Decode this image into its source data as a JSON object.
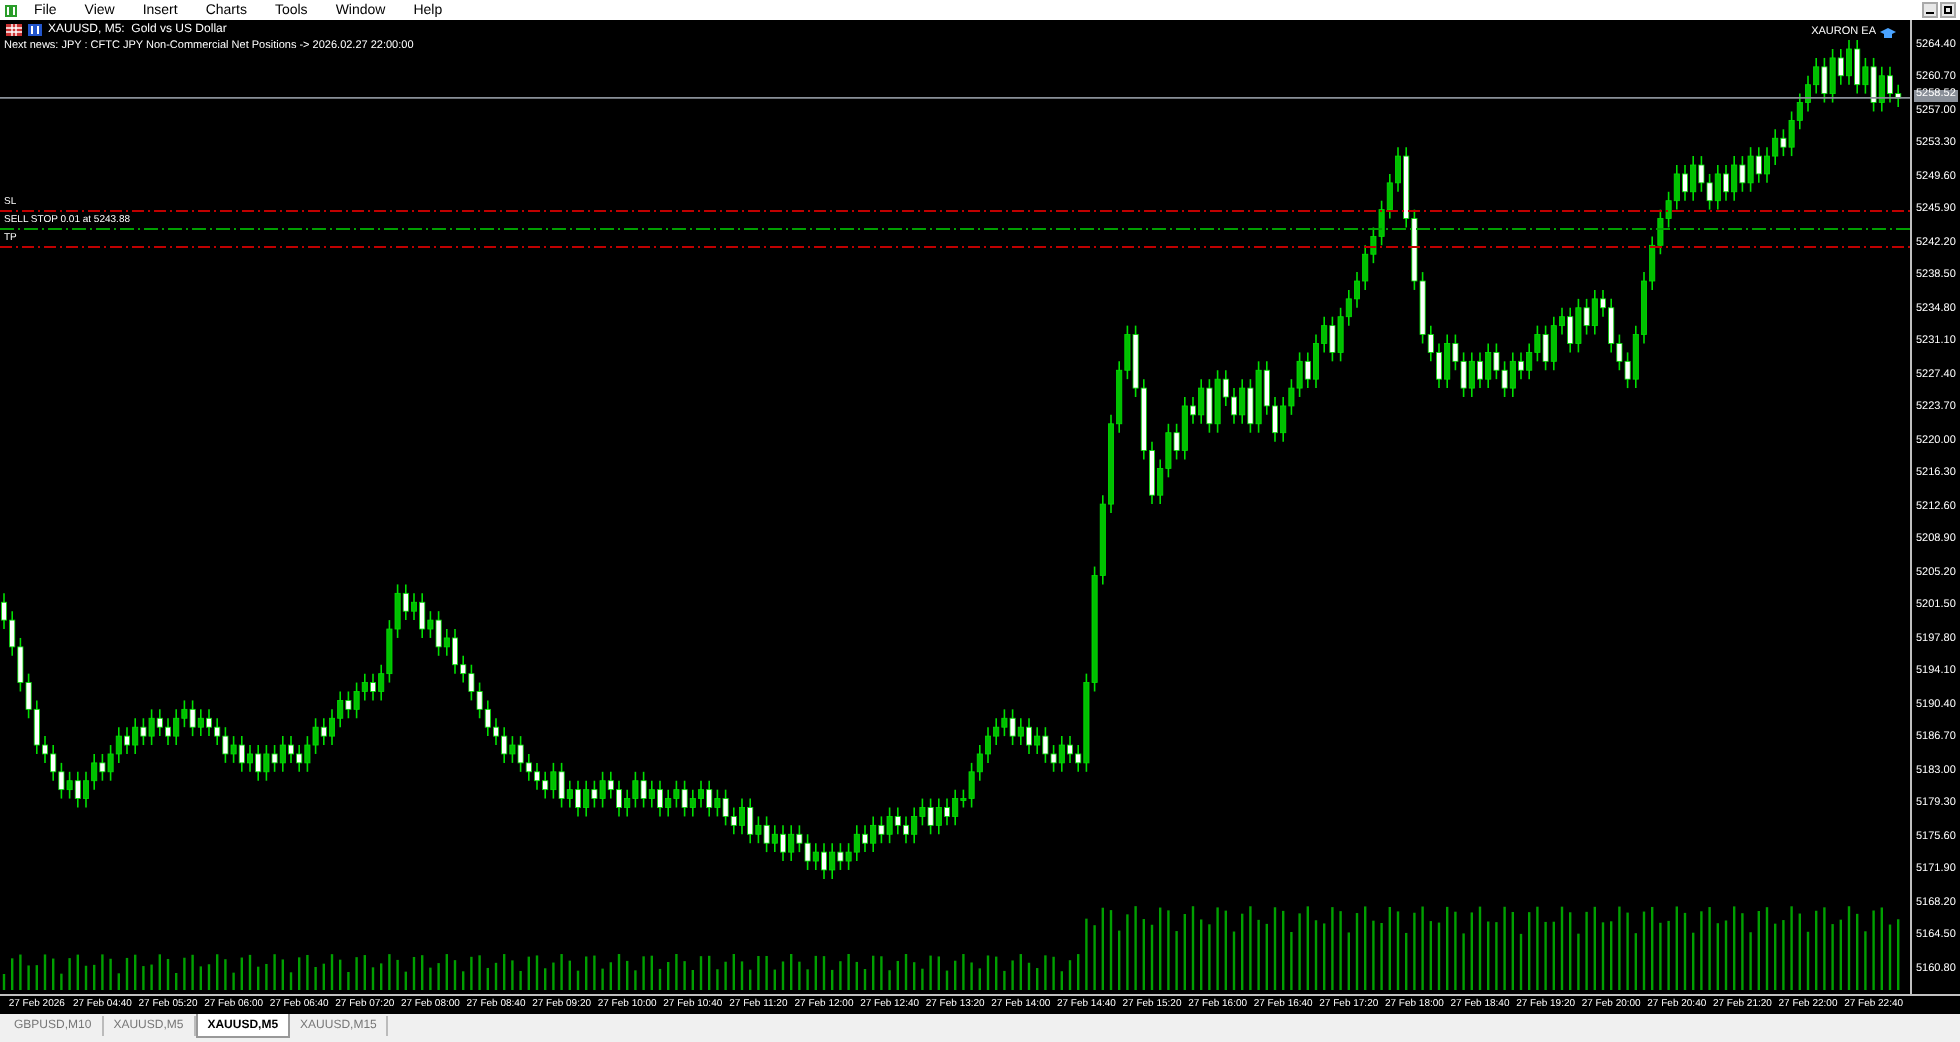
{
  "menu": {
    "items": [
      "File",
      "View",
      "Insert",
      "Charts",
      "Tools",
      "Window",
      "Help"
    ]
  },
  "chart": {
    "title": "XAUUSD, M5:  Gold vs US Dollar",
    "news": "Next news: JPY : CFTC JPY Non-Commercial Net Positions -> 2026.02.27 22:00:00",
    "expert": "XAURON EA",
    "lines": [
      {
        "kind": "sl",
        "label": "SL",
        "color": "#c00000"
      },
      {
        "kind": "order",
        "label": "SELL STOP 0.01 at 5243.88",
        "color": "#00a000"
      },
      {
        "kind": "tp",
        "label": "TP",
        "color": "#c00000"
      }
    ],
    "current_price": "5258.52",
    "chart_data": {
      "type": "candlestick",
      "ylim": [
        5158.1,
        5267.25
      ],
      "yticks": [
        {
          "value": 5264.4,
          "label": "5264.40"
        },
        {
          "value": 5260.7,
          "label": "5260.70"
        },
        {
          "value": 5257.0,
          "label": "5257.00"
        },
        {
          "value": 5253.3,
          "label": "5253.30"
        },
        {
          "value": 5249.6,
          "label": "5249.60"
        },
        {
          "value": 5245.9,
          "label": "5245.90"
        },
        {
          "value": 5242.2,
          "label": "5242.20"
        },
        {
          "value": 5238.5,
          "label": "5238.50"
        },
        {
          "value": 5234.8,
          "label": "5234.80"
        },
        {
          "value": 5231.1,
          "label": "5231.10"
        },
        {
          "value": 5227.4,
          "label": "5227.40"
        },
        {
          "value": 5223.7,
          "label": "5223.70"
        },
        {
          "value": 5220.0,
          "label": "5220.00"
        },
        {
          "value": 5216.3,
          "label": "5216.30"
        },
        {
          "value": 5212.6,
          "label": "5212.60"
        },
        {
          "value": 5208.9,
          "label": "5208.90"
        },
        {
          "value": 5205.2,
          "label": "5205.20"
        },
        {
          "value": 5201.5,
          "label": "5201.50"
        },
        {
          "value": 5197.8,
          "label": "5197.80"
        },
        {
          "value": 5194.1,
          "label": "5194.10"
        },
        {
          "value": 5190.4,
          "label": "5190.40"
        },
        {
          "value": 5186.7,
          "label": "5186.70"
        },
        {
          "value": 5183.0,
          "label": "5183.00"
        },
        {
          "value": 5179.3,
          "label": "5179.30"
        },
        {
          "value": 5175.6,
          "label": "5175.60"
        },
        {
          "value": 5171.9,
          "label": "5171.90"
        },
        {
          "value": 5168.2,
          "label": "5168.20"
        },
        {
          "value": 5164.5,
          "label": "5164.50"
        },
        {
          "value": 5160.8,
          "label": "5160.80"
        }
      ],
      "categories": [
        null,
        null,
        null,
        null,
        "27 Feb 2026",
        null,
        null,
        null,
        null,
        null,
        null,
        null,
        "27 Feb 04:40",
        null,
        null,
        null,
        null,
        null,
        null,
        null,
        "27 Feb 05:20",
        null,
        null,
        null,
        null,
        null,
        null,
        null,
        "27 Feb 06:00",
        null,
        null,
        null,
        null,
        null,
        null,
        null,
        "27 Feb 06:40",
        null,
        null,
        null,
        null,
        null,
        null,
        null,
        "27 Feb 07:20",
        null,
        null,
        null,
        null,
        null,
        null,
        null,
        "27 Feb 08:00",
        null,
        null,
        null,
        null,
        null,
        null,
        null,
        "27 Feb 08:40",
        null,
        null,
        null,
        null,
        null,
        null,
        null,
        "27 Feb 09:20",
        null,
        null,
        null,
        null,
        null,
        null,
        null,
        "27 Feb 10:00",
        null,
        null,
        null,
        null,
        null,
        null,
        null,
        "27 Feb 10:40",
        null,
        null,
        null,
        null,
        null,
        null,
        null,
        "27 Feb 11:20",
        null,
        null,
        null,
        null,
        null,
        null,
        null,
        "27 Feb 12:00",
        null,
        null,
        null,
        null,
        null,
        null,
        null,
        "27 Feb 12:40",
        null,
        null,
        null,
        null,
        null,
        null,
        null,
        "27 Feb 13:20",
        null,
        null,
        null,
        null,
        null,
        null,
        null,
        "27 Feb 14:00",
        null,
        null,
        null,
        null,
        null,
        null,
        null,
        "27 Feb 14:40",
        null,
        null,
        null,
        null,
        null,
        null,
        null,
        "27 Feb 15:20",
        null,
        null,
        null,
        null,
        null,
        null,
        null,
        "27 Feb 16:00",
        null,
        null,
        null,
        null,
        null,
        null,
        null,
        "27 Feb 16:40",
        null,
        null,
        null,
        null,
        null,
        null,
        null,
        "27 Feb 17:20",
        null,
        null,
        null,
        null,
        null,
        null,
        null,
        "27 Feb 18:00",
        null,
        null,
        null,
        null,
        null,
        null,
        null,
        "27 Feb 18:40",
        null,
        null,
        null,
        null,
        null,
        null,
        null,
        "27 Feb 19:20",
        null,
        null,
        null,
        null,
        null,
        null,
        null,
        "27 Feb 20:00",
        null,
        null,
        null,
        null,
        null,
        null,
        null,
        "27 Feb 20:40",
        null,
        null,
        null,
        null,
        null,
        null,
        null,
        "27 Feb 21:20",
        null,
        null,
        null,
        null,
        null,
        null,
        null,
        "27 Feb 22:00",
        null,
        null,
        null,
        null,
        null,
        null,
        null,
        "27 Feb 22:40",
        null,
        null,
        null
      ],
      "ohlc": [
        [
          5202,
          5203,
          5199,
          5200
        ],
        [
          5200,
          5201,
          5196,
          5197
        ],
        [
          5197,
          5198,
          5192,
          5193
        ],
        [
          5193,
          5194,
          5189,
          5190
        ],
        [
          5190,
          5191,
          5185,
          5186
        ],
        [
          5186,
          5187,
          5184,
          5185
        ],
        [
          5185,
          5186,
          5182,
          5183
        ],
        [
          5183,
          5184,
          5180,
          5181
        ],
        [
          5181,
          5183,
          5180,
          5182
        ],
        [
          5182,
          5183,
          5179,
          5180
        ],
        [
          5180,
          5183,
          5179,
          5182
        ],
        [
          5182,
          5185,
          5181,
          5184
        ],
        [
          5184,
          5185,
          5182,
          5183
        ],
        [
          5183,
          5186,
          5182,
          5185
        ],
        [
          5185,
          5188,
          5184,
          5187
        ],
        [
          5187,
          5188,
          5185,
          5186
        ],
        [
          5186,
          5189,
          5185,
          5188
        ],
        [
          5188,
          5189,
          5186,
          5187
        ],
        [
          5187,
          5190,
          5186,
          5189
        ],
        [
          5189,
          5190,
          5187,
          5188
        ],
        [
          5188,
          5189,
          5186,
          5187
        ],
        [
          5187,
          5190,
          5186,
          5189
        ],
        [
          5189,
          5191,
          5188,
          5190
        ],
        [
          5190,
          5191,
          5187,
          5188
        ],
        [
          5188,
          5190,
          5187,
          5189
        ],
        [
          5189,
          5190,
          5187,
          5188
        ],
        [
          5188,
          5189,
          5186,
          5187
        ],
        [
          5187,
          5188,
          5184,
          5185
        ],
        [
          5185,
          5187,
          5184,
          5186
        ],
        [
          5186,
          5187,
          5183,
          5184
        ],
        [
          5184,
          5186,
          5183,
          5185
        ],
        [
          5185,
          5186,
          5182,
          5183
        ],
        [
          5183,
          5186,
          5182,
          5185
        ],
        [
          5185,
          5186,
          5183,
          5184
        ],
        [
          5184,
          5187,
          5183,
          5186
        ],
        [
          5186,
          5187,
          5184,
          5185
        ],
        [
          5185,
          5186,
          5183,
          5184
        ],
        [
          5184,
          5187,
          5183,
          5186
        ],
        [
          5186,
          5189,
          5185,
          5188
        ],
        [
          5188,
          5189,
          5186,
          5187
        ],
        [
          5187,
          5190,
          5186,
          5189
        ],
        [
          5189,
          5192,
          5188,
          5191
        ],
        [
          5191,
          5192,
          5189,
          5190
        ],
        [
          5190,
          5193,
          5189,
          5192
        ],
        [
          5192,
          5194,
          5191,
          5193
        ],
        [
          5193,
          5194,
          5191,
          5192
        ],
        [
          5192,
          5195,
          5191,
          5194
        ],
        [
          5194,
          5200,
          5193,
          5199
        ],
        [
          5199,
          5204,
          5198,
          5203
        ],
        [
          5203,
          5204,
          5200,
          5201
        ],
        [
          5201,
          5203,
          5200,
          5202
        ],
        [
          5202,
          5203,
          5198,
          5199
        ],
        [
          5199,
          5201,
          5198,
          5200
        ],
        [
          5200,
          5201,
          5196,
          5197
        ],
        [
          5197,
          5199,
          5196,
          5198
        ],
        [
          5198,
          5199,
          5194,
          5195
        ],
        [
          5195,
          5196,
          5193,
          5194
        ],
        [
          5194,
          5195,
          5191,
          5192
        ],
        [
          5192,
          5193,
          5189,
          5190
        ],
        [
          5190,
          5191,
          5187,
          5188
        ],
        [
          5188,
          5189,
          5186,
          5187
        ],
        [
          5187,
          5188,
          5184,
          5185
        ],
        [
          5185,
          5187,
          5184,
          5186
        ],
        [
          5186,
          5187,
          5183,
          5184
        ],
        [
          5184,
          5185,
          5182,
          5183
        ],
        [
          5183,
          5184,
          5181,
          5182
        ],
        [
          5182,
          5183,
          5180,
          5181
        ],
        [
          5181,
          5184,
          5180,
          5183
        ],
        [
          5183,
          5184,
          5179,
          5180
        ],
        [
          5180,
          5182,
          5179,
          5181
        ],
        [
          5181,
          5182,
          5178,
          5179
        ],
        [
          5179,
          5182,
          5178,
          5181
        ],
        [
          5181,
          5182,
          5179,
          5180
        ],
        [
          5180,
          5183,
          5179,
          5182
        ],
        [
          5182,
          5183,
          5180,
          5181
        ],
        [
          5181,
          5182,
          5178,
          5179
        ],
        [
          5179,
          5181,
          5178,
          5180
        ],
        [
          5180,
          5183,
          5179,
          5182
        ],
        [
          5182,
          5183,
          5179,
          5180
        ],
        [
          5180,
          5182,
          5179,
          5181
        ],
        [
          5181,
          5182,
          5178,
          5179
        ],
        [
          5179,
          5181,
          5178,
          5180
        ],
        [
          5180,
          5182,
          5179,
          5181
        ],
        [
          5181,
          5182,
          5178,
          5179
        ],
        [
          5179,
          5181,
          5178,
          5180
        ],
        [
          5180,
          5182,
          5179,
          5181
        ],
        [
          5181,
          5182,
          5178,
          5179
        ],
        [
          5179,
          5181,
          5178,
          5180
        ],
        [
          5180,
          5181,
          5177,
          5178
        ],
        [
          5178,
          5179,
          5176,
          5177
        ],
        [
          5177,
          5180,
          5176,
          5179
        ],
        [
          5179,
          5180,
          5175,
          5176
        ],
        [
          5176,
          5178,
          5175,
          5177
        ],
        [
          5177,
          5178,
          5174,
          5175
        ],
        [
          5175,
          5177,
          5174,
          5176
        ],
        [
          5176,
          5177,
          5173,
          5174
        ],
        [
          5174,
          5177,
          5173,
          5176
        ],
        [
          5176,
          5177,
          5174,
          5175
        ],
        [
          5175,
          5176,
          5172,
          5173
        ],
        [
          5173,
          5175,
          5172,
          5174
        ],
        [
          5174,
          5175,
          5171,
          5172
        ],
        [
          5172,
          5175,
          5171,
          5174
        ],
        [
          5174,
          5175,
          5172,
          5173
        ],
        [
          5173,
          5175,
          5172,
          5174
        ],
        [
          5174,
          5177,
          5173,
          5176
        ],
        [
          5176,
          5177,
          5174,
          5175
        ],
        [
          5175,
          5178,
          5174,
          5177
        ],
        [
          5177,
          5178,
          5175,
          5176
        ],
        [
          5176,
          5179,
          5175,
          5178
        ],
        [
          5178,
          5179,
          5176,
          5177
        ],
        [
          5177,
          5178,
          5175,
          5176
        ],
        [
          5176,
          5179,
          5175,
          5178
        ],
        [
          5178,
          5180,
          5177,
          5179
        ],
        [
          5179,
          5180,
          5176,
          5177
        ],
        [
          5177,
          5180,
          5176,
          5179
        ],
        [
          5179,
          5180,
          5177,
          5178
        ],
        [
          5178,
          5181,
          5177,
          5180
        ],
        [
          5180,
          5181,
          5179,
          5180
        ],
        [
          5180,
          5184,
          5179,
          5183
        ],
        [
          5183,
          5186,
          5182,
          5185
        ],
        [
          5185,
          5188,
          5184,
          5187
        ],
        [
          5187,
          5189,
          5186,
          5188
        ],
        [
          5188,
          5190,
          5187,
          5189
        ],
        [
          5189,
          5190,
          5186,
          5187
        ],
        [
          5187,
          5189,
          5186,
          5188
        ],
        [
          5188,
          5189,
          5185,
          5186
        ],
        [
          5186,
          5188,
          5185,
          5187
        ],
        [
          5187,
          5188,
          5184,
          5185
        ],
        [
          5185,
          5186,
          5183,
          5184
        ],
        [
          5184,
          5187,
          5183,
          5186
        ],
        [
          5186,
          5187,
          5184,
          5185
        ],
        [
          5185,
          5186,
          5183,
          5184
        ],
        [
          5184,
          5194,
          5183,
          5193
        ],
        [
          5193,
          5206,
          5192,
          5205
        ],
        [
          5205,
          5214,
          5204,
          5213
        ],
        [
          5213,
          5223,
          5212,
          5222
        ],
        [
          5222,
          5229,
          5221,
          5228
        ],
        [
          5228,
          5233,
          5227,
          5232
        ],
        [
          5232,
          5233,
          5225,
          5226
        ],
        [
          5226,
          5227,
          5218,
          5219
        ],
        [
          5219,
          5220,
          5213,
          5214
        ],
        [
          5214,
          5218,
          5213,
          5217
        ],
        [
          5217,
          5222,
          5216,
          5221
        ],
        [
          5221,
          5222,
          5218,
          5219
        ],
        [
          5219,
          5225,
          5218,
          5224
        ],
        [
          5224,
          5225,
          5222,
          5223
        ],
        [
          5223,
          5227,
          5222,
          5226
        ],
        [
          5226,
          5227,
          5221,
          5222
        ],
        [
          5222,
          5228,
          5221,
          5227
        ],
        [
          5227,
          5228,
          5224,
          5225
        ],
        [
          5225,
          5226,
          5222,
          5223
        ],
        [
          5223,
          5227,
          5222,
          5226
        ],
        [
          5226,
          5227,
          5221,
          5222
        ],
        [
          5222,
          5229,
          5221,
          5228
        ],
        [
          5228,
          5229,
          5223,
          5224
        ],
        [
          5224,
          5225,
          5220,
          5221
        ],
        [
          5221,
          5225,
          5220,
          5224
        ],
        [
          5224,
          5227,
          5223,
          5226
        ],
        [
          5226,
          5230,
          5225,
          5229
        ],
        [
          5229,
          5230,
          5226,
          5227
        ],
        [
          5227,
          5232,
          5226,
          5231
        ],
        [
          5231,
          5234,
          5230,
          5233
        ],
        [
          5233,
          5234,
          5229,
          5230
        ],
        [
          5230,
          5235,
          5229,
          5234
        ],
        [
          5234,
          5237,
          5233,
          5236
        ],
        [
          5236,
          5239,
          5235,
          5238
        ],
        [
          5238,
          5242,
          5237,
          5241
        ],
        [
          5241,
          5244,
          5240,
          5243
        ],
        [
          5243,
          5247,
          5242,
          5246
        ],
        [
          5246,
          5250,
          5245,
          5249
        ],
        [
          5249,
          5253,
          5248,
          5252
        ],
        [
          5252,
          5253,
          5244,
          5245
        ],
        [
          5245,
          5246,
          5237,
          5238
        ],
        [
          5238,
          5239,
          5231,
          5232
        ],
        [
          5232,
          5233,
          5229,
          5230
        ],
        [
          5230,
          5231,
          5226,
          5227
        ],
        [
          5227,
          5232,
          5226,
          5231
        ],
        [
          5231,
          5232,
          5228,
          5229
        ],
        [
          5229,
          5230,
          5225,
          5226
        ],
        [
          5226,
          5230,
          5225,
          5229
        ],
        [
          5229,
          5230,
          5226,
          5227
        ],
        [
          5227,
          5231,
          5226,
          5230
        ],
        [
          5230,
          5231,
          5227,
          5228
        ],
        [
          5228,
          5229,
          5225,
          5226
        ],
        [
          5226,
          5230,
          5225,
          5229
        ],
        [
          5229,
          5230,
          5227,
          5228
        ],
        [
          5228,
          5231,
          5227,
          5230
        ],
        [
          5230,
          5233,
          5229,
          5232
        ],
        [
          5232,
          5233,
          5228,
          5229
        ],
        [
          5229,
          5234,
          5228,
          5233
        ],
        [
          5233,
          5235,
          5232,
          5234
        ],
        [
          5234,
          5235,
          5230,
          5231
        ],
        [
          5231,
          5236,
          5230,
          5235
        ],
        [
          5235,
          5236,
          5232,
          5233
        ],
        [
          5233,
          5237,
          5232,
          5236
        ],
        [
          5236,
          5237,
          5234,
          5235
        ],
        [
          5235,
          5236,
          5230,
          5231
        ],
        [
          5231,
          5232,
          5228,
          5229
        ],
        [
          5229,
          5230,
          5226,
          5227
        ],
        [
          5227,
          5233,
          5226,
          5232
        ],
        [
          5232,
          5239,
          5231,
          5238
        ],
        [
          5238,
          5243,
          5237,
          5242
        ],
        [
          5242,
          5246,
          5241,
          5245
        ],
        [
          5245,
          5248,
          5244,
          5247
        ],
        [
          5247,
          5251,
          5246,
          5250
        ],
        [
          5250,
          5251,
          5247,
          5248
        ],
        [
          5248,
          5252,
          5247,
          5251
        ],
        [
          5251,
          5252,
          5248,
          5249
        ],
        [
          5249,
          5250,
          5246,
          5247
        ],
        [
          5247,
          5251,
          5246,
          5250
        ],
        [
          5250,
          5251,
          5247,
          5248
        ],
        [
          5248,
          5252,
          5247,
          5251
        ],
        [
          5251,
          5252,
          5248,
          5249
        ],
        [
          5249,
          5253,
          5248,
          5252
        ],
        [
          5252,
          5253,
          5249,
          5250
        ],
        [
          5250,
          5253,
          5249,
          5252
        ],
        [
          5252,
          5255,
          5251,
          5254
        ],
        [
          5254,
          5255,
          5252,
          5253
        ],
        [
          5253,
          5257,
          5252,
          5256
        ],
        [
          5256,
          5259,
          5255,
          5258
        ],
        [
          5258,
          5261,
          5257,
          5260
        ],
        [
          5260,
          5263,
          5259,
          5262
        ],
        [
          5262,
          5263,
          5258,
          5259
        ],
        [
          5259,
          5264,
          5258,
          5263
        ],
        [
          5263,
          5264,
          5260,
          5261
        ],
        [
          5261,
          5265,
          5260,
          5264
        ],
        [
          5264,
          5265,
          5259,
          5260
        ],
        [
          5260,
          5263,
          5259,
          5262
        ],
        [
          5262,
          5263,
          5257,
          5258
        ],
        [
          5258,
          5262,
          5257,
          5261
        ],
        [
          5261,
          5262,
          5258,
          5259
        ],
        [
          5259,
          5260,
          5257.5,
          5258.5
        ]
      ]
    }
  },
  "tabs": [
    {
      "label": "GBPUSD,M10",
      "selected": false
    },
    {
      "label": "XAUUSD,M5",
      "selected": false
    },
    {
      "label": "XAUUSD,M5",
      "selected": true
    },
    {
      "label": "XAUUSD,M15",
      "selected": false
    }
  ]
}
